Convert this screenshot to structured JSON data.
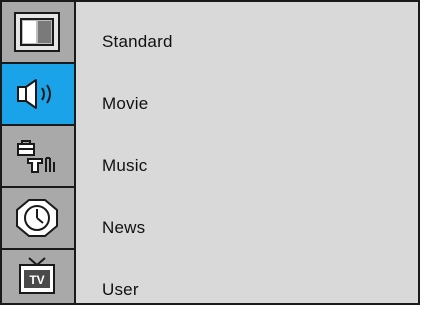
{
  "sidebar": {
    "tabs": [
      {
        "icon": "picture-icon",
        "active": false
      },
      {
        "icon": "sound-icon",
        "active": true
      },
      {
        "icon": "tools-setup-icon",
        "active": false
      },
      {
        "icon": "clock-icon",
        "active": false
      },
      {
        "icon": "tv-icon",
        "active": false,
        "icon_text": "TV"
      }
    ]
  },
  "menu": {
    "items": [
      {
        "label": "Standard"
      },
      {
        "label": "Movie"
      },
      {
        "label": "Music"
      },
      {
        "label": "News"
      },
      {
        "label": "User"
      }
    ]
  },
  "colors": {
    "active_tab": "#1aa3e8",
    "sidebar": "#a9a9a9",
    "panel": "#d9d9d9",
    "border": "#1a1a1a"
  }
}
